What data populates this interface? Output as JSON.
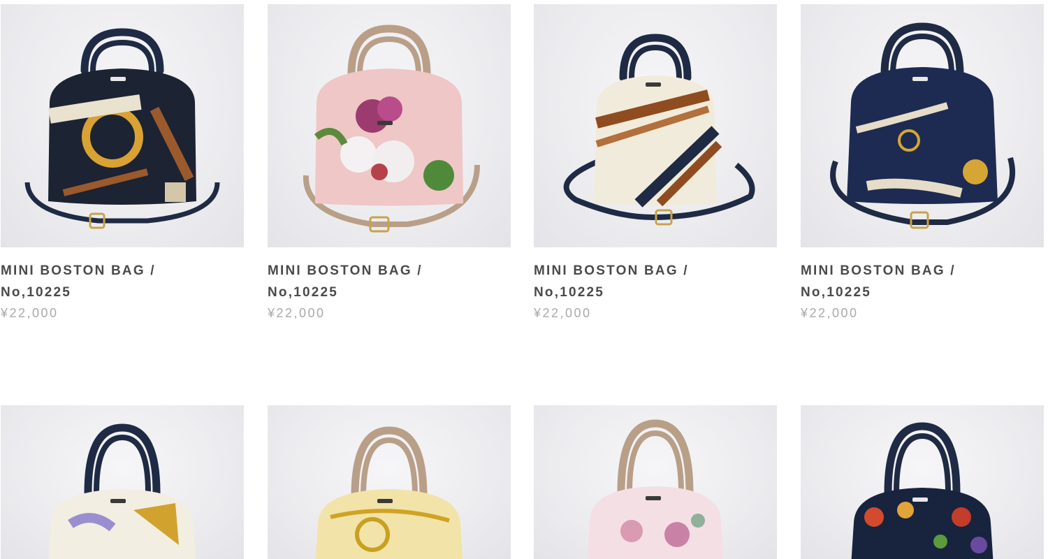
{
  "products": [
    {
      "title_line1": "MINI BOSTON BAG /",
      "title_line2": "No,10225",
      "price": "¥22,000",
      "strap_color": "#1f2a44",
      "pattern": "navy-gold-chain"
    },
    {
      "title_line1": "MINI BOSTON BAG /",
      "title_line2": "No,10225",
      "price": "¥22,000",
      "strap_color": "#b99f88",
      "pattern": "pink-floral"
    },
    {
      "title_line1": "MINI BOSTON BAG /",
      "title_line2": "No,10225",
      "price": "¥22,000",
      "strap_color": "#1f2a44",
      "pattern": "cream-brown-stripe"
    },
    {
      "title_line1": "MINI BOSTON BAG /",
      "title_line2": "No,10225",
      "price": "¥22,000",
      "strap_color": "#1f2a44",
      "pattern": "navy-gold-jewelry"
    },
    {
      "strap_color": "#1f2a44",
      "pattern": "cream-purple-gold"
    },
    {
      "strap_color": "#b99f88",
      "pattern": "yellow-baroque"
    },
    {
      "strap_color": "#b99f88",
      "pattern": "pink-floral-light"
    },
    {
      "strap_color": "#1f2a44",
      "pattern": "navy-fruit"
    }
  ]
}
